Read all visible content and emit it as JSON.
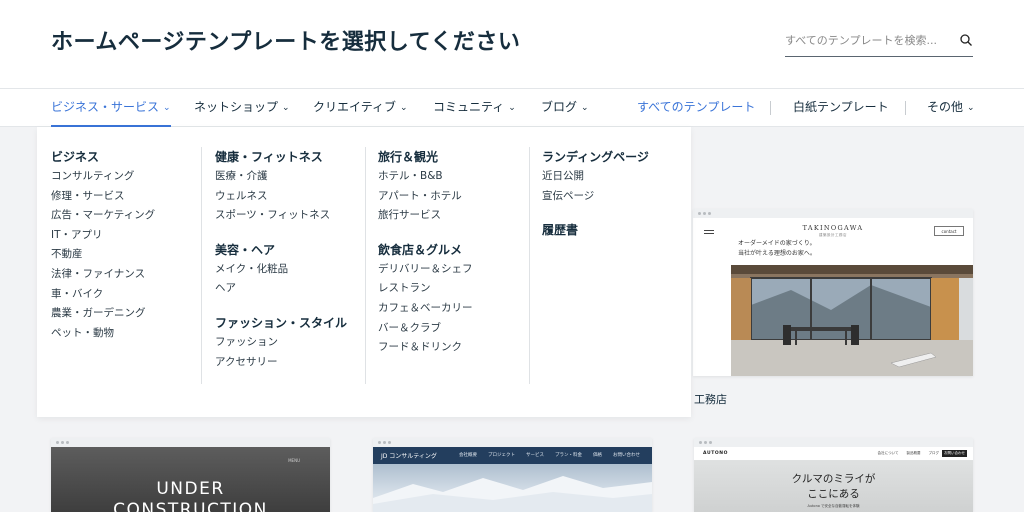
{
  "header": {
    "title": "ホームページテンプレートを選択してください",
    "search_placeholder": "すべてのテンプレートを検索..."
  },
  "nav": {
    "items": [
      {
        "label": "ビジネス・サービス"
      },
      {
        "label": "ネットショップ"
      },
      {
        "label": "クリエイティブ"
      },
      {
        "label": "コミュニティ"
      },
      {
        "label": "ブログ"
      }
    ],
    "all_templates": "すべてのテンプレート",
    "blank_templates": "白紙テンプレート",
    "other": "その他"
  },
  "dropdown": {
    "columns": [
      [
        {
          "title": "ビジネス",
          "items": [
            "コンサルティング",
            "修理・サービス",
            "広告・マーケティング",
            "IT・アプリ",
            "不動産",
            "法律・ファイナンス",
            "車・バイク",
            "農業・ガーデニング",
            "ペット・動物"
          ]
        }
      ],
      [
        {
          "title": "健康・フィットネス",
          "items": [
            "医療・介護",
            "ウェルネス",
            "スポーツ・フィットネス"
          ]
        },
        {
          "title": "美容・ヘア",
          "items": [
            "メイク・化粧品",
            "ヘア"
          ]
        },
        {
          "title": "ファッション・スタイル",
          "items": [
            "ファッション",
            "アクセサリー"
          ]
        }
      ],
      [
        {
          "title": "旅行＆観光",
          "items": [
            "ホテル・B&B",
            "アパート・ホテル",
            "旅行サービス"
          ]
        },
        {
          "title": "飲食店＆グルメ",
          "items": [
            "デリバリー＆シェフ",
            "レストラン",
            "カフェ＆ベーカリー",
            "バー＆クラブ",
            "フード＆ドリンク"
          ]
        }
      ],
      [
        {
          "title": "ランディングページ",
          "items": [
            "近日公開",
            "宣伝ページ"
          ]
        },
        {
          "title": "履歴書",
          "items": []
        }
      ]
    ]
  },
  "templates": {
    "main": {
      "label": "工務店",
      "logo": "TAKINOGAWA",
      "logo_sub": "建築設計工務店",
      "button": "contact",
      "copy_line1": "オーダーメイドの家づくり。",
      "copy_line2": "当社が叶える理想のお家へ。"
    },
    "under_construction": {
      "line1": "UNDER",
      "line2": "CONSTRUCTION",
      "menu": "MENU"
    },
    "consulting": {
      "logo": "JD コンサルティング",
      "nav": [
        "会社概要",
        "プロジェクト",
        "サービス",
        "プラン・料金",
        "価格",
        "お問い合わせ"
      ]
    },
    "autono": {
      "logo": "AUTONO",
      "nav": [
        "会社について",
        "製品概要",
        "ブログ"
      ],
      "button": "お問い合わせ",
      "title_line1": "クルマのミライが",
      "title_line2": "ここにある",
      "sub": "Autono で安全な自動運転を体験"
    }
  },
  "colors": {
    "accent": "#3a74d8",
    "text": "#162d3d",
    "background": "#f2f3f5"
  }
}
